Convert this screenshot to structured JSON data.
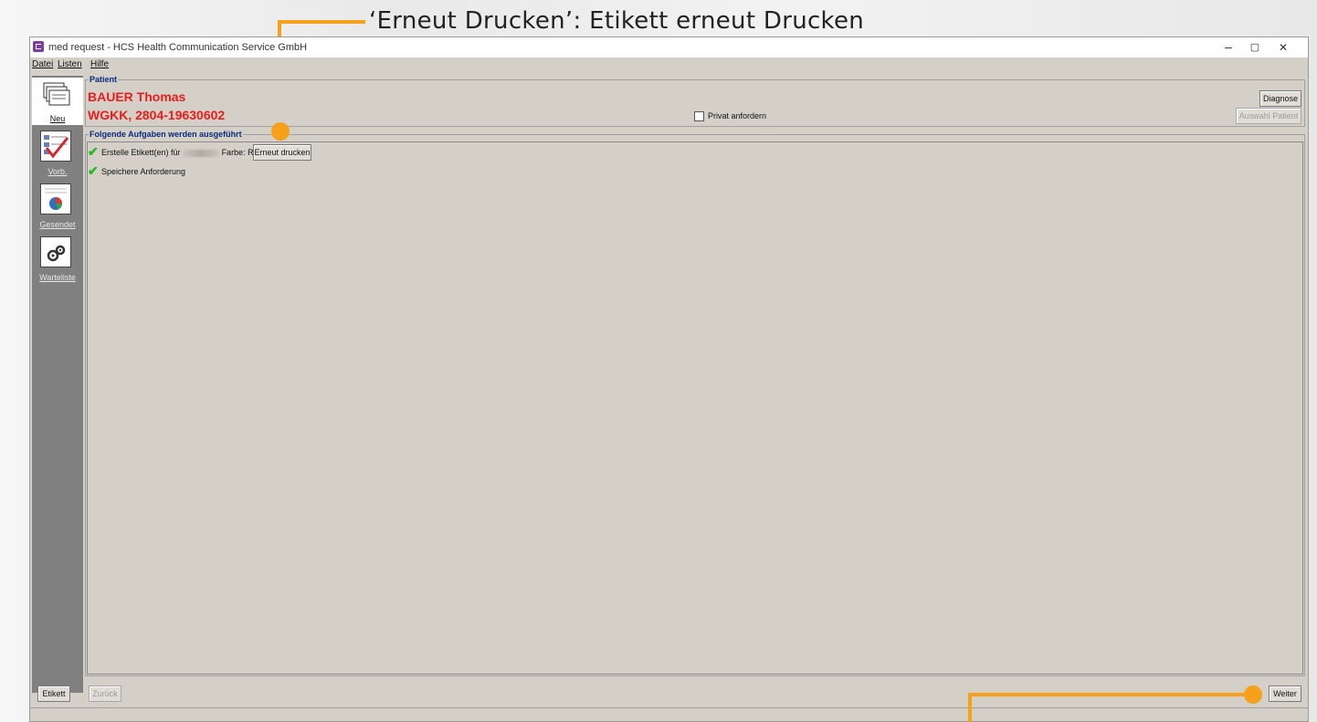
{
  "annotation": {
    "top_callout": "‘Erneut Drucken’: Etikett erneut Drucken",
    "accent_color": "#f5a11a"
  },
  "window": {
    "title": "med request - HCS Health Communication Service GmbH",
    "minimize": "–",
    "restore": "▢",
    "close": "✕"
  },
  "menu": {
    "items": [
      "Datei",
      "Listen",
      "Hilfe"
    ]
  },
  "nav": {
    "items": [
      {
        "label": "Neu",
        "icon": "stack-icon"
      },
      {
        "label": "Vorb.",
        "icon": "checklist-icon"
      },
      {
        "label": "Gesendet",
        "icon": "chart-document-icon"
      },
      {
        "label": "Warteliste",
        "icon": "gears-document-icon"
      }
    ]
  },
  "patient": {
    "group_label": "Patient",
    "name": "BAUER Thomas",
    "insurance": "WGKK, 2804-19630602",
    "privat_label": "Privat anfordern",
    "privat_checked": false,
    "diagnose_button": "Diagnose",
    "auswahl_button": "Auswahl Patient",
    "name_color": "#ee1c1c"
  },
  "tasks": {
    "group_label": "Folgende Aufgaben werden ausgeführt",
    "items": [
      {
        "text_before": "Erstelle Etikett(en) für",
        "text_after": "Farbe: Rot",
        "button": "Erneut drucken",
        "done": true
      },
      {
        "text_before": "Speichere Anforderung",
        "done": true
      }
    ]
  },
  "footer": {
    "etikett_button": "Etikett",
    "zurueck_button": "Zurück",
    "weiter_button": "Weiter"
  }
}
